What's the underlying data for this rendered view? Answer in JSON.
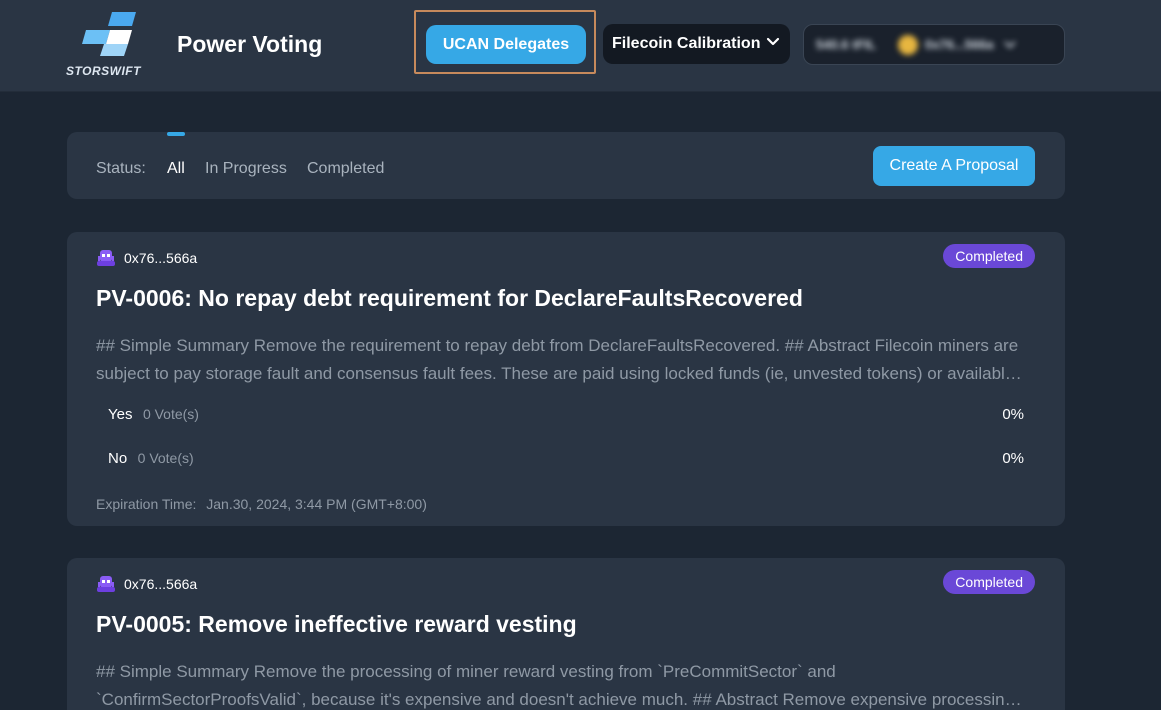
{
  "header": {
    "logo_text": "STORSWIFT",
    "app_title": "Power Voting",
    "ucan_button": "UCAN Delegates",
    "network_button": "Filecoin Calibration",
    "wallet": {
      "balance": "540.6 tFIL",
      "address": "0x76...566a"
    }
  },
  "filter": {
    "status_label": "Status:",
    "tabs": [
      "All",
      "In Progress",
      "Completed"
    ],
    "active_tab": "All",
    "create_button": "Create A Proposal"
  },
  "proposals": [
    {
      "author": "0x76...566a",
      "status": "Completed",
      "title": "PV-0006: No repay debt requirement for DeclareFaultsRecovered",
      "summary": "## Simple Summary Remove the requirement to repay debt from DeclareFaultsRecovered. ## Abstract Filecoin miners are subject to pay storage fault and consensus fault fees. These are paid using locked funds (ie, unvested tokens) or available balance, and in the case of insufficient funds, the miner accrues debt.",
      "votes": [
        {
          "option": "Yes",
          "count": "0 Vote(s)",
          "percent": "0%"
        },
        {
          "option": "No",
          "count": "0 Vote(s)",
          "percent": "0%"
        }
      ],
      "expiry_label": "Expiration Time:",
      "expiry_value": "Jan.30, 2024, 3:44 PM (GMT+8:00)"
    },
    {
      "author": "0x76...566a",
      "status": "Completed",
      "title": "PV-0005: Remove ineffective reward vesting",
      "summary": "## Simple Summary Remove the processing of miner reward vesting from `PreCommitSector` and `ConfirmSectorProofsValid`, because it's expensive and doesn't achieve much. ## Abstract Remove expensive processing of miner reward vesting from frequently called methods."
    }
  ],
  "colors": {
    "accent": "#36a8e6",
    "badge": "#6a48d7",
    "page_bg": "#1c2633",
    "card_bg": "#2a3544",
    "highlight_frame": "#c78a5c"
  }
}
